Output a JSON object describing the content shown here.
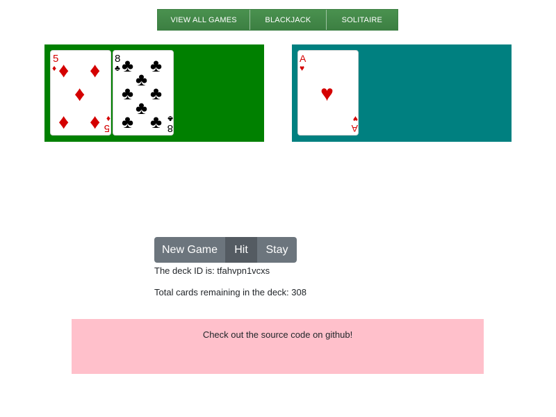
{
  "nav": {
    "items": [
      {
        "label": "VIEW ALL GAMES"
      },
      {
        "label": "BLACKJACK"
      },
      {
        "label": "SOLITAIRE"
      }
    ]
  },
  "player_hand": {
    "color": "#008000",
    "cards": [
      {
        "rank": "5",
        "suit": "diamonds",
        "suit_symbol": "♦",
        "color": "#d40000"
      },
      {
        "rank": "8",
        "suit": "clubs",
        "suit_symbol": "♣",
        "color": "#000000"
      }
    ]
  },
  "dealer_hand": {
    "color": "#008080",
    "cards": [
      {
        "rank": "A",
        "suit": "hearts",
        "suit_symbol": "♥",
        "color": "#d40000"
      }
    ]
  },
  "controls": {
    "new_game": "New Game",
    "hit": "Hit",
    "stay": "Stay"
  },
  "deck": {
    "id_text": "The deck ID is: tfahvpn1vcxs",
    "remaining_text": "Total cards remaining in the deck: 308"
  },
  "footer": {
    "text": "Check out the source code on github!",
    "color": "#ffc0cb"
  }
}
